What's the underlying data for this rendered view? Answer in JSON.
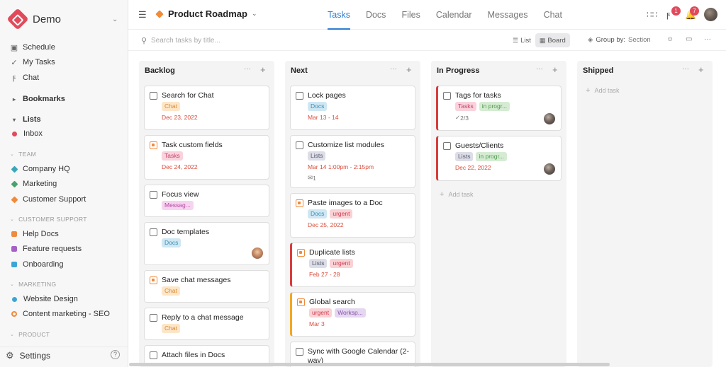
{
  "workspace": {
    "name": "Demo"
  },
  "sidebar": {
    "top_items": [
      {
        "label": "Schedule",
        "icon": "calendar-icon"
      },
      {
        "label": "My Tasks",
        "icon": "check-circle-icon"
      },
      {
        "label": "Chat",
        "icon": "lightning-icon"
      }
    ],
    "bookmarks": "Bookmarks",
    "lists": "Lists",
    "inbox": "Inbox",
    "sections": [
      {
        "title": "TEAM",
        "items": [
          {
            "label": "Company HQ",
            "color": "#3aa6b8",
            "shape": "diamond"
          },
          {
            "label": "Marketing",
            "color": "#4aa36c",
            "shape": "diamond"
          },
          {
            "label": "Customer Support",
            "color": "#f08a3c",
            "shape": "diamond"
          }
        ]
      },
      {
        "title": "CUSTOMER SUPPORT",
        "items": [
          {
            "label": "Help Docs",
            "color": "#f08a3c",
            "shape": "square"
          },
          {
            "label": "Feature requests",
            "color": "#a660c7",
            "shape": "square"
          },
          {
            "label": "Onboarding",
            "color": "#3aa6d8",
            "shape": "square"
          }
        ]
      },
      {
        "title": "MARKETING",
        "items": [
          {
            "label": "Website Design",
            "color": "#3aa6d8",
            "shape": "circle"
          },
          {
            "label": "Content marketing - SEO",
            "color": "#f08a3c",
            "shape": "ring"
          }
        ]
      },
      {
        "title": "PRODUCT",
        "items": []
      }
    ],
    "settings": "Settings",
    "help": "?"
  },
  "header": {
    "project": "Product Roadmap",
    "tabs": [
      "Tasks",
      "Docs",
      "Files",
      "Calendar",
      "Messages",
      "Chat"
    ],
    "active_tab": "Tasks",
    "notif_badges": [
      "1",
      "7"
    ]
  },
  "toolbar": {
    "search_placeholder": "Search tasks by title...",
    "view_list": "List",
    "view_board": "Board",
    "group_by_label": "Group by:",
    "group_by_value": "Section"
  },
  "board": {
    "columns": [
      {
        "title": "Backlog",
        "cards": [
          {
            "title": "Search for Chat",
            "tags": [
              "Chat"
            ],
            "date": "Dec 23, 2022"
          },
          {
            "title": "Task custom fields",
            "tags": [
              "Tasks"
            ],
            "date": "Dec 24, 2022",
            "priority": true
          },
          {
            "title": "Focus view",
            "tags": [
              "Messag..."
            ]
          },
          {
            "title": "Doc templates",
            "tags": [
              "Docs"
            ],
            "avatar": "woman"
          },
          {
            "title": "Save chat messages",
            "tags": [
              "Chat"
            ],
            "priority": true
          },
          {
            "title": "Reply to a chat message",
            "tags": [
              "Chat"
            ]
          },
          {
            "title": "Attach files in Docs",
            "tags": []
          }
        ]
      },
      {
        "title": "Next",
        "cards": [
          {
            "title": "Lock pages",
            "tags": [
              "Docs"
            ],
            "date": "Mar 13 - 14"
          },
          {
            "title": "Customize list modules",
            "tags": [
              "Lists"
            ],
            "date": "Mar 14 1:00pm - 2:15pm",
            "comments": "1"
          },
          {
            "title": "Paste images to a Doc",
            "tags": [
              "Docs",
              "urgent"
            ],
            "date": "Dec 25, 2022",
            "priority": true
          },
          {
            "title": "Duplicate lists",
            "tags": [
              "Lists",
              "urgent"
            ],
            "date": "Feb 27 - 28",
            "priority": true,
            "flag": "red"
          },
          {
            "title": "Global search",
            "tags": [
              "urgent",
              "Worksp..."
            ],
            "date": "Mar 3",
            "priority": true,
            "flag": "amber"
          },
          {
            "title": "Sync with Google Calendar (2-way)",
            "tags": []
          }
        ]
      },
      {
        "title": "In Progress",
        "cards": [
          {
            "title": "Tags for tasks",
            "tags": [
              "Tasks",
              "in progr..."
            ],
            "subtasks": "2/3",
            "avatar": "man",
            "flag": "red"
          },
          {
            "title": "Guests/Clients",
            "tags": [
              "Lists",
              "in progr..."
            ],
            "date": "Dec 22, 2022",
            "avatar": "man",
            "flag": "red"
          }
        ],
        "add": "Add task"
      },
      {
        "title": "Shipped",
        "cards": [],
        "add": "Add task"
      }
    ]
  },
  "colors": {
    "accent": "#2d7dd2",
    "brand": "#e04a5b",
    "danger": "#d93c3c"
  }
}
